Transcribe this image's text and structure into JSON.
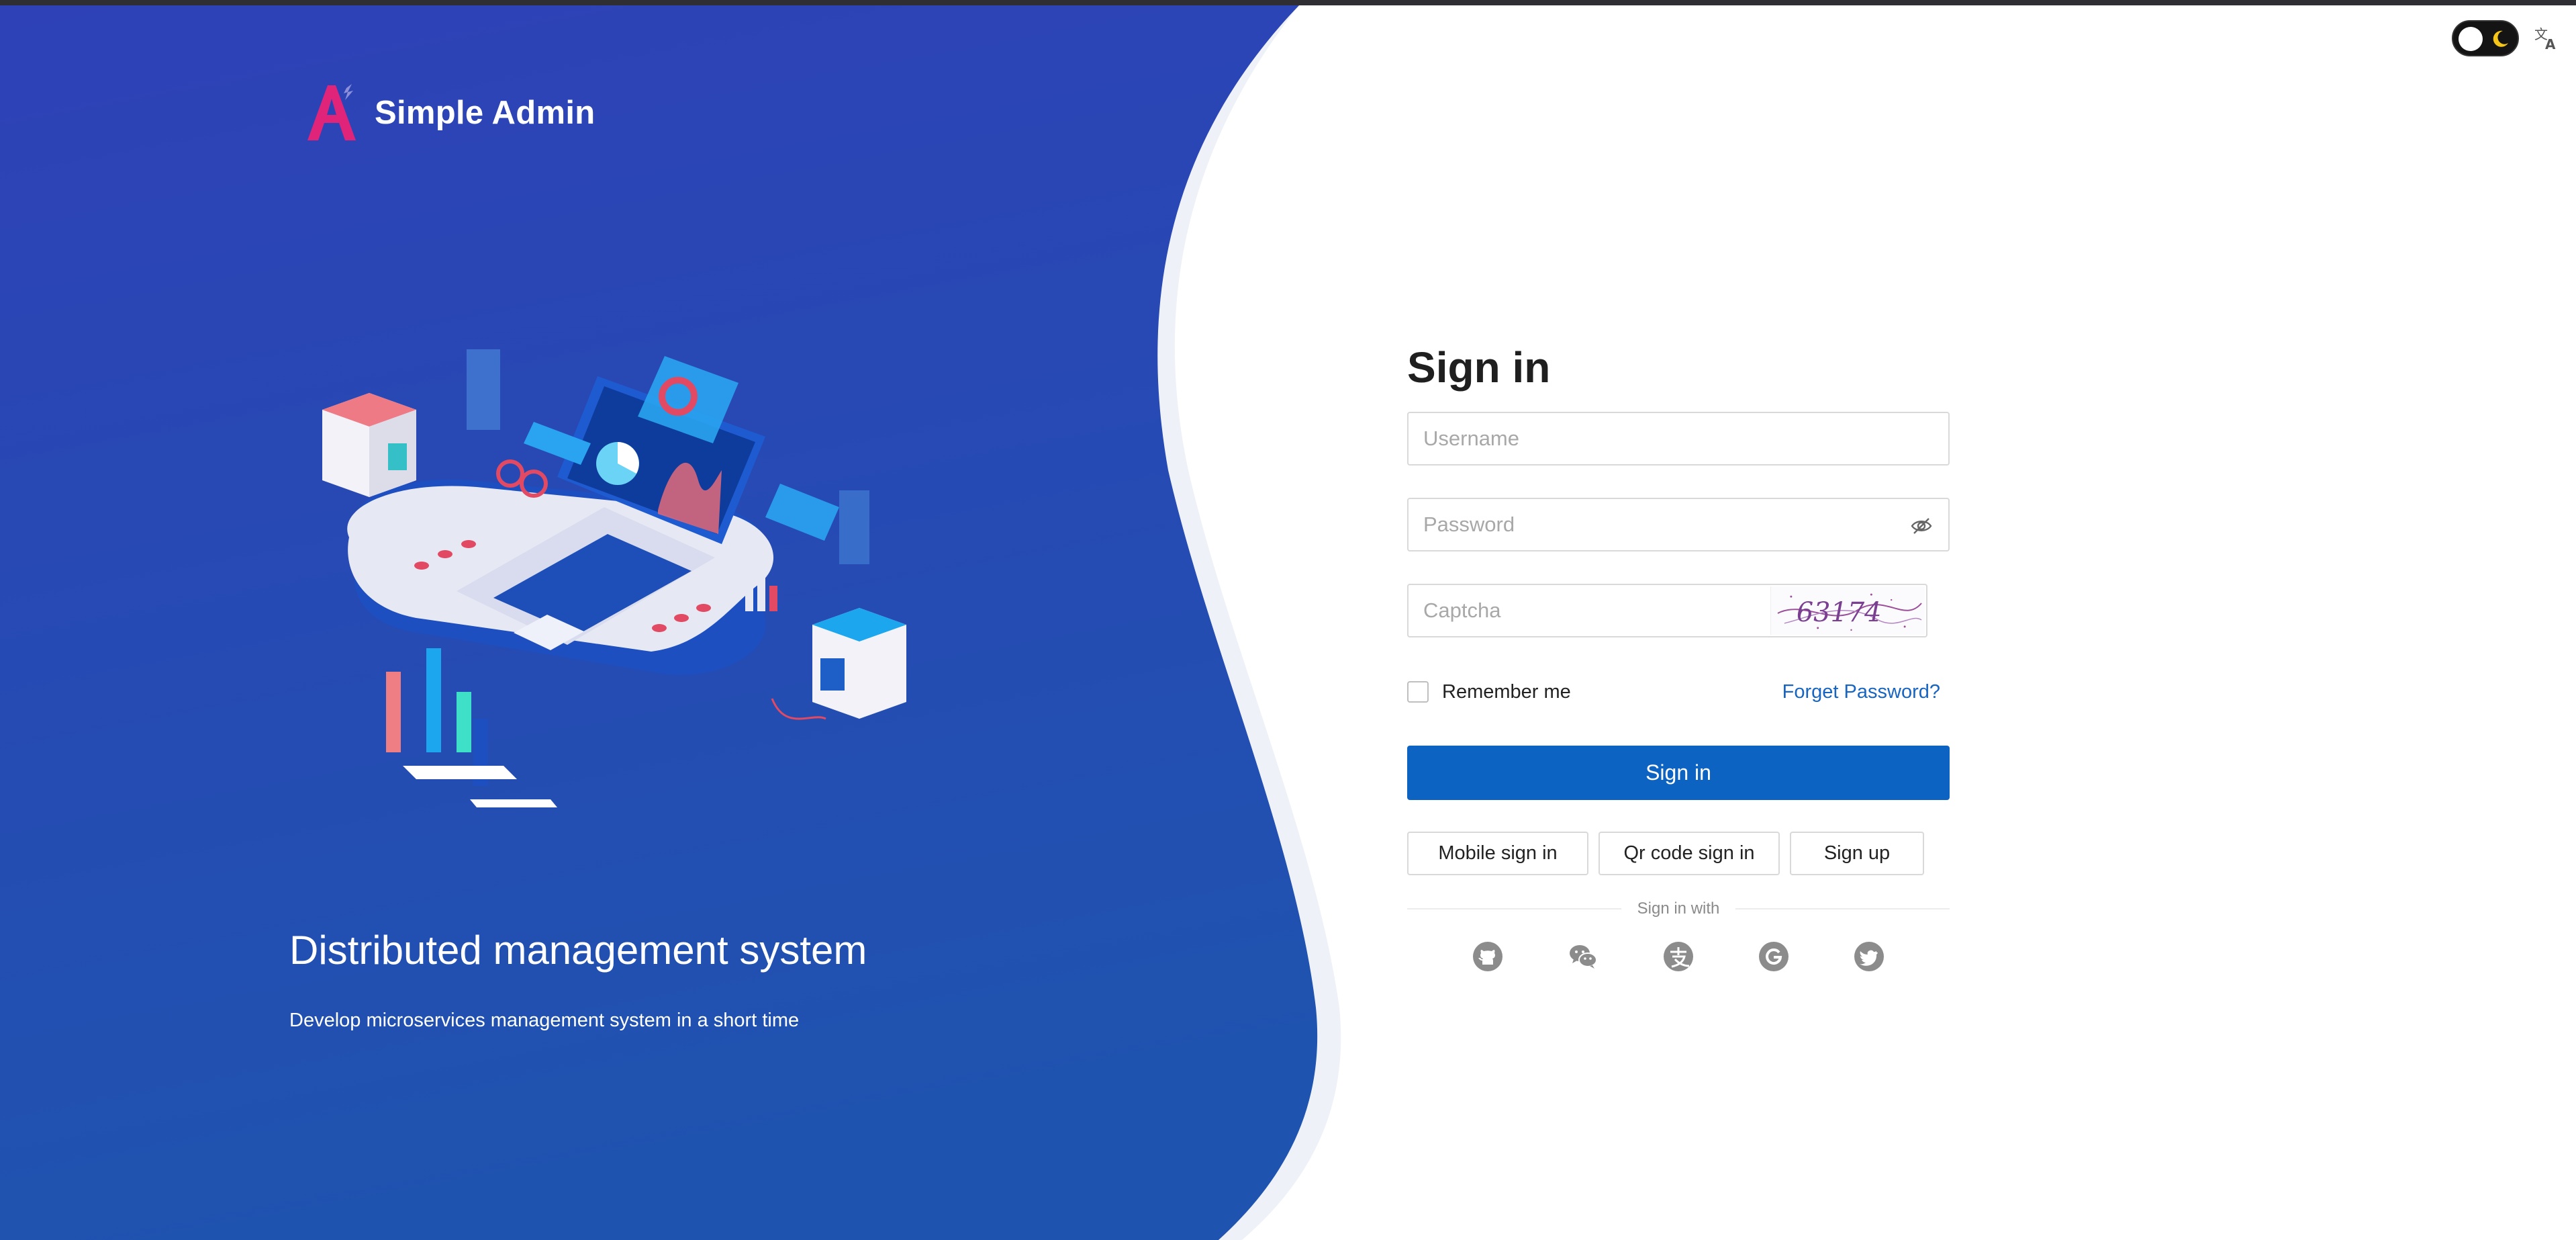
{
  "brand": {
    "name": "Simple Admin",
    "logo_icon": "triangle-a-logo-icon"
  },
  "hero": {
    "title": "Distributed management system",
    "subtitle": "Develop microservices management system in a short time",
    "illustration": "isometric-laptop-dashboard-illustration"
  },
  "topbar": {
    "theme_toggle_icon": "moon-icon",
    "language_icon": "translate-icon"
  },
  "form": {
    "title": "Sign in",
    "username_placeholder": "Username",
    "password_placeholder": "Password",
    "captcha_placeholder": "Captcha",
    "captcha_text": "63174",
    "remember_label": "Remember me",
    "forget_label": "Forget Password?",
    "submit_label": "Sign in",
    "alt_buttons": [
      "Mobile sign in",
      "Qr code sign in",
      "Sign up"
    ],
    "divider_label": "Sign in with",
    "social_icons": [
      "github-icon",
      "wechat-icon",
      "alipay-icon",
      "google-icon",
      "twitter-icon"
    ]
  },
  "colors": {
    "panel_top": "#2e41b7",
    "panel_bottom": "#1f53b0",
    "primary": "#0d63c1",
    "link": "#1765c0",
    "social_gray": "#8c8c8c"
  }
}
